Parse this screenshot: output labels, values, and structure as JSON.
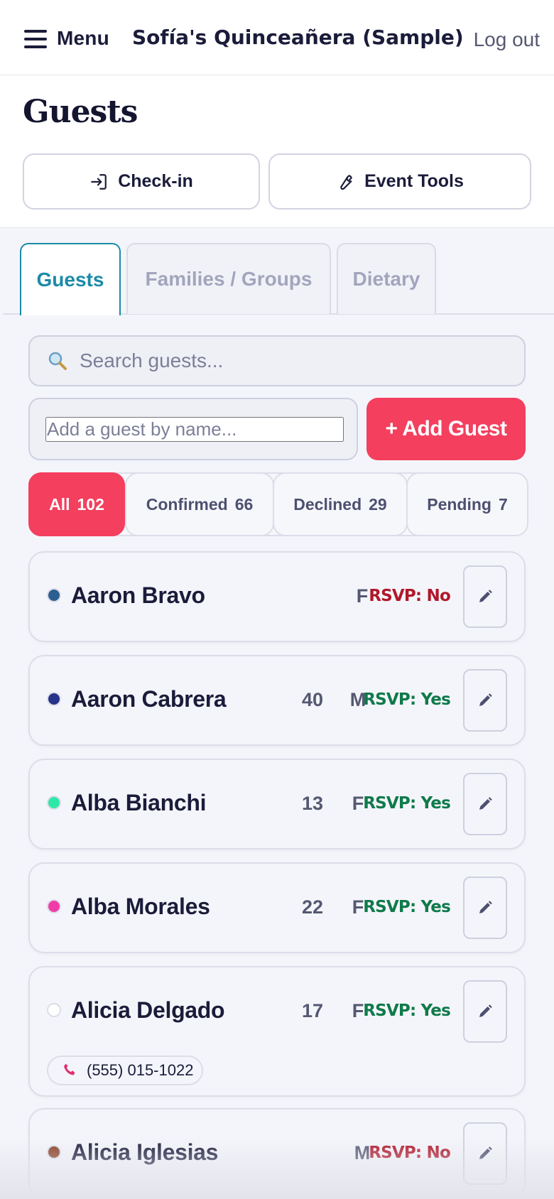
{
  "nav": {
    "menu_label": "Menu",
    "event_title": "Sofía's Quinceañera (Sample)",
    "logout_label": "Log out"
  },
  "header": {
    "title": "Guests",
    "checkin_label": "Check-in",
    "tools_label": "Event Tools"
  },
  "tabs": [
    {
      "label": "Guests",
      "active": true
    },
    {
      "label": "Families / Groups",
      "active": false
    },
    {
      "label": "Dietary",
      "active": false
    }
  ],
  "search": {
    "placeholder": "Search guests..."
  },
  "add_guest": {
    "placeholder": "Add a guest by name...",
    "button_label": "+ Add Guest"
  },
  "filters": [
    {
      "label": "All",
      "count": "102",
      "active": true
    },
    {
      "label": "Confirmed",
      "count": "66",
      "active": false
    },
    {
      "label": "Declined",
      "count": "29",
      "active": false
    },
    {
      "label": "Pending",
      "count": "7",
      "active": false
    }
  ],
  "guests": [
    {
      "name": "Aaron Bravo",
      "age": "",
      "gender": "F",
      "rsvp": "RSVP: No",
      "dot_color": "#2c5f8f",
      "phone": ""
    },
    {
      "name": "Aaron Cabrera",
      "age": "40",
      "gender": "M",
      "rsvp": "RSVP: Yes",
      "dot_color": "#26338a",
      "phone": ""
    },
    {
      "name": "Alba Bianchi",
      "age": "13",
      "gender": "F",
      "rsvp": "RSVP: Yes",
      "dot_color": "#2ee8a8",
      "phone": ""
    },
    {
      "name": "Alba Morales",
      "age": "22",
      "gender": "F",
      "rsvp": "RSVP: Yes",
      "dot_color": "#f03ca8",
      "phone": ""
    },
    {
      "name": "Alicia Delgado",
      "age": "17",
      "gender": "F",
      "rsvp": "RSVP: Yes",
      "dot_color": "#ffffff",
      "phone": "(555) 015-1022"
    },
    {
      "name": "Alicia Iglesias",
      "age": "",
      "gender": "M",
      "rsvp": "RSVP: No",
      "dot_color": "#8a3e22",
      "phone": ""
    }
  ],
  "colors": {
    "accent": "#f43f5e",
    "tab_active": "#1b8aa8",
    "rsvp_yes": "#0f7a4a",
    "rsvp_no": "#b0182a"
  },
  "icons": {
    "menu": "hamburger-icon",
    "checkin": "login-arrow-icon",
    "tools": "wrench-icon",
    "search": "magnifier-icon",
    "edit": "pencil-icon",
    "phone": "phone-icon"
  }
}
